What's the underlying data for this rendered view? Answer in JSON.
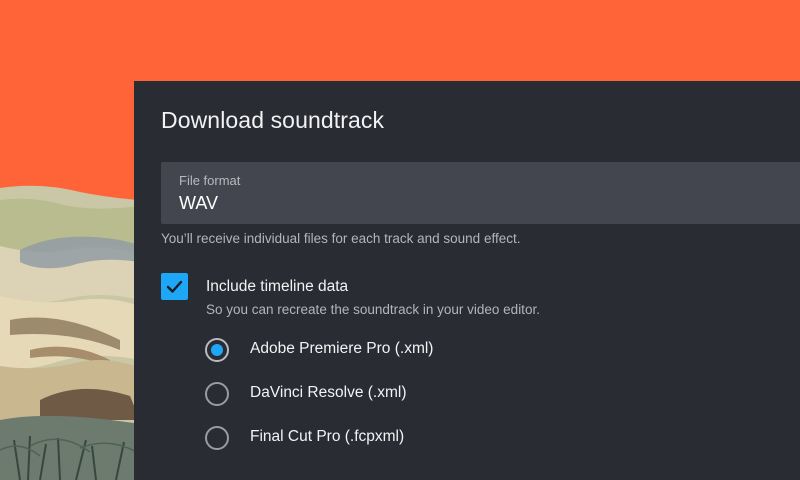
{
  "dialog": {
    "title": "Download soundtrack",
    "file_format": {
      "label": "File format",
      "value": "WAV"
    },
    "helper_text": "You’ll receive individual files for each track and sound effect.",
    "timeline": {
      "checked": true,
      "label": "Include timeline data",
      "description": "So you can recreate the soundtrack in your video editor."
    },
    "editors": [
      {
        "label": "Adobe Premiere Pro (.xml)",
        "selected": true
      },
      {
        "label": "DaVinci Resolve (.xml)",
        "selected": false
      },
      {
        "label": "Final Cut Pro (.fcpxml)",
        "selected": false
      }
    ]
  },
  "colors": {
    "background": "#ff6438",
    "dialog": "#2a2c33",
    "field": "#43464f",
    "accent": "#1ea7f7"
  },
  "icons": {
    "checkbox": "checkmark-icon"
  }
}
